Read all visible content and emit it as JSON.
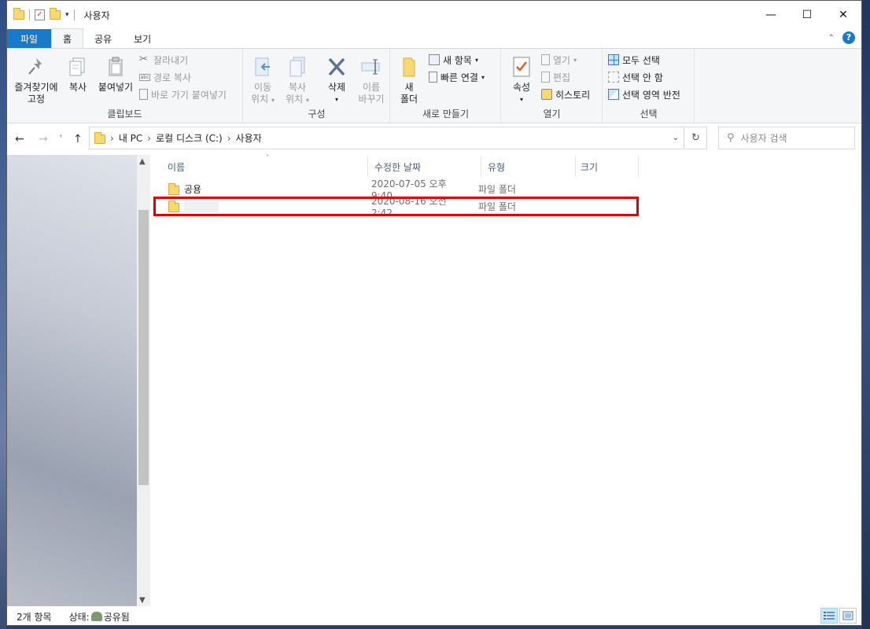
{
  "window": {
    "title": "사용자"
  },
  "tabs": [
    "파일",
    "홈",
    "공유",
    "보기"
  ],
  "ribbon": {
    "clipboard": {
      "group_label": "클립보드",
      "pin_label_1": "즐겨찾기에",
      "pin_label_2": "고정",
      "copy_label": "복사",
      "paste_label": "붙여넣기",
      "cut_label": "잘라내기",
      "copy_path_label": "경로 복사",
      "paste_shortcut_label": "바로 가기 붙여넣기"
    },
    "organize": {
      "group_label": "구성",
      "move_to_1": "이동",
      "move_to_2": "위치",
      "copy_to_1": "복사",
      "copy_to_2": "위치",
      "delete_label": "삭제",
      "rename_1": "이름",
      "rename_2": "바꾸기"
    },
    "new": {
      "group_label": "새로 만들기",
      "new_folder_1": "새",
      "new_folder_2": "폴더",
      "new_item_label": "새 항목",
      "easy_access_label": "빠른 연결"
    },
    "open": {
      "group_label": "열기",
      "properties_label": "속성",
      "open_label": "열기",
      "edit_label": "편집",
      "history_label": "히스토리"
    },
    "select": {
      "group_label": "선택",
      "select_all_label": "모두 선택",
      "select_none_label": "선택 안 함",
      "invert_label": "선택 영역 반전"
    }
  },
  "address": {
    "crumbs": [
      "내 PC",
      "로컬 디스크 (C:)",
      "사용자"
    ]
  },
  "search": {
    "placeholder": "사용자 검색"
  },
  "columns": {
    "name": "이름",
    "modified": "수정한 날짜",
    "type": "유형",
    "size": "크기"
  },
  "files": [
    {
      "name": "공용",
      "modified": "2020-07-05 오후 9:40",
      "type": "파일 폴더"
    },
    {
      "name": "",
      "modified": "2020-08-16 오전 2:42",
      "type": "파일 폴더"
    }
  ],
  "status": {
    "count": "2개 항목",
    "state": "상태:",
    "shared": "공유됨"
  },
  "colors": {
    "accent": "#1979ca",
    "highlight": "#e00000",
    "folder": "#f8d775"
  }
}
